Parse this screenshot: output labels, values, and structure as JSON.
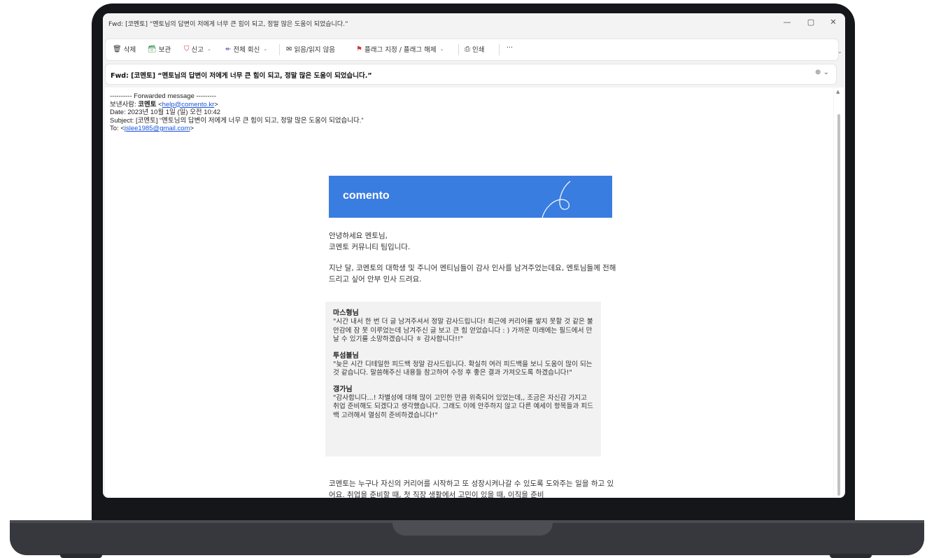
{
  "window": {
    "title": "Fwd: [코멘토] “멘토님의 답변이 저에게 너무 큰 힘이 되고, 정말 많은 도움이 되었습니다.”",
    "minimize": "—",
    "maximize": "▢",
    "close": "✕"
  },
  "toolbar": {
    "delete": "삭제",
    "archive": "보관",
    "report": "신고",
    "reply_all": "전체 회신",
    "read_unread": "읽음/읽지 않음",
    "flag": "플래그 지정 / 플래그 해제",
    "print": "인쇄",
    "more": "···",
    "chevron": "⌄"
  },
  "subject": "Fwd: [코멘토] “멘토님의 답변이 저에게 너무 큰 힘이 되고, 정말 많은 도움이 되었습니다.”",
  "forward": {
    "line": "---------- Forwarded message ---------",
    "from_label": "보낸사람:",
    "from_name": "코멘토",
    "from_email": "help@comento.kr",
    "date_label": "Date:",
    "date": "2023년 10월 1일 (일) 오전 10:42",
    "subject_label": "Subject:",
    "subject": "[코멘토] “멘토님의 답변이 저에게 너무 큰 힘이 되고, 정말 많은 도움이 되었습니다.”",
    "to_label": "To:",
    "to_email": "jslee1985@gmail.com"
  },
  "email": {
    "logo": "comento",
    "greeting1": "안녕하세요 멘토님,",
    "greeting2": "코멘토 커뮤니티 팀입니다.",
    "intro": "지난 달, 코멘토의 대학생 및 주니어 멘티님들이 감사 인사를 남겨주었는데요, 멘토님들께 전해드리고 싶어 안부 인사 드려요.",
    "quotes": [
      {
        "name": "마스형님",
        "text": "\"시간 내서 한 번 더 글 남겨주셔서 정말 감사드립니다! 최근에 커리어를 쌓지 못할 것 같은 불안감에 잠 못 이루었는데 남겨주신 글 보고 큰 힘 얻었습니다 : ) 가까운 미래에는 필드에서 만날 수 있기를 소망하겠습니다 ㅎ 감사합니다!!\""
      },
      {
        "name": "투섬볼님",
        "text": "\"늦은 시간 디테일한 피드백 정말 감사드립니다. 확실히 여러 피드백을 보니 도움이 많이 되는 것 같습니다. 말씀해주신 내용들 참고하여 수정 후 좋은 결과 가져오도록 하겠습니다!\""
      },
      {
        "name": "갱가님",
        "text": "\"감사합니다...! 차별성에 대해 많이 고민한 만큼 위축되어 있었는데,, 조금은 자신감 가지고 취업 준비해도 되겠다고 생각했습니다. 그래도 이에 안주하지 않고 다른 예세이 항목들과 피드백 고려해서 열심히 준비하겠습니다!\""
      }
    ],
    "closing": "코멘토는 누구나 자신의 커리어를 시작하고 또 성장시켜나갈 수 있도록 도와주는 일을 하고 있어요. 취업을 준비할 때, 첫 직장 생활에서 고민이 있을 때, 이직을 준비"
  },
  "colors": {
    "brand": "#3a7de0",
    "link": "#1a56db",
    "flag": "#d13438",
    "reply": "#6b4fbb"
  }
}
